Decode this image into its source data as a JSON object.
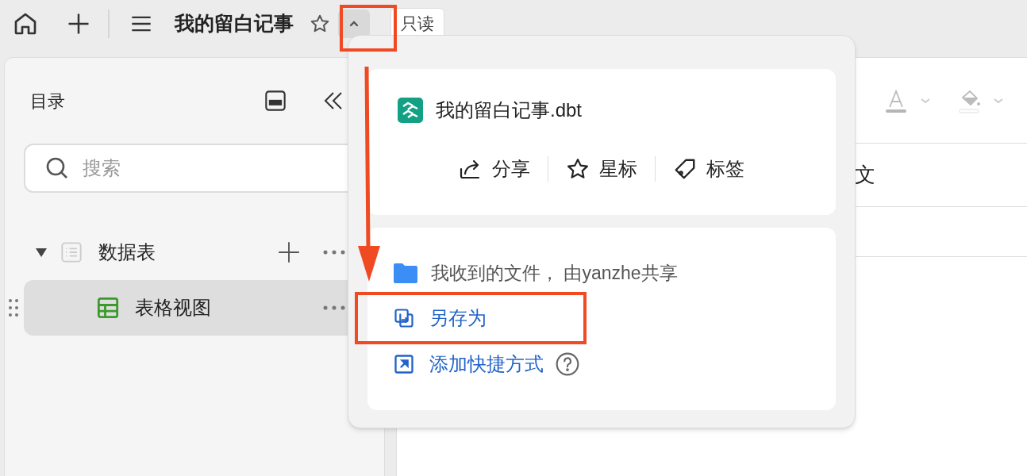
{
  "topbar": {
    "title": "我的留白记事",
    "starred": false,
    "collapse_highlighted": true,
    "badge": "只读"
  },
  "sidebar": {
    "title": "目录",
    "search": {
      "placeholder": "搜索"
    },
    "tree": [
      {
        "label": "数据表",
        "expanded": true,
        "selected": false,
        "children": [
          {
            "label": "表格视图",
            "selected": true
          }
        ]
      }
    ]
  },
  "main": {
    "visible_text": "文"
  },
  "popover": {
    "file_name": "我的留白记事.dbt",
    "actions": [
      {
        "kind": "share",
        "label": "分享"
      },
      {
        "kind": "star",
        "label": "星标"
      },
      {
        "kind": "tag",
        "label": "标签"
      }
    ],
    "location": "我收到的文件， 由yanzhe共享",
    "links": [
      {
        "kind": "save-as",
        "label": "另存为",
        "highlighted": true,
        "help": false
      },
      {
        "kind": "shortcut",
        "label": "添加快捷方式",
        "highlighted": false,
        "help": true
      }
    ]
  }
}
